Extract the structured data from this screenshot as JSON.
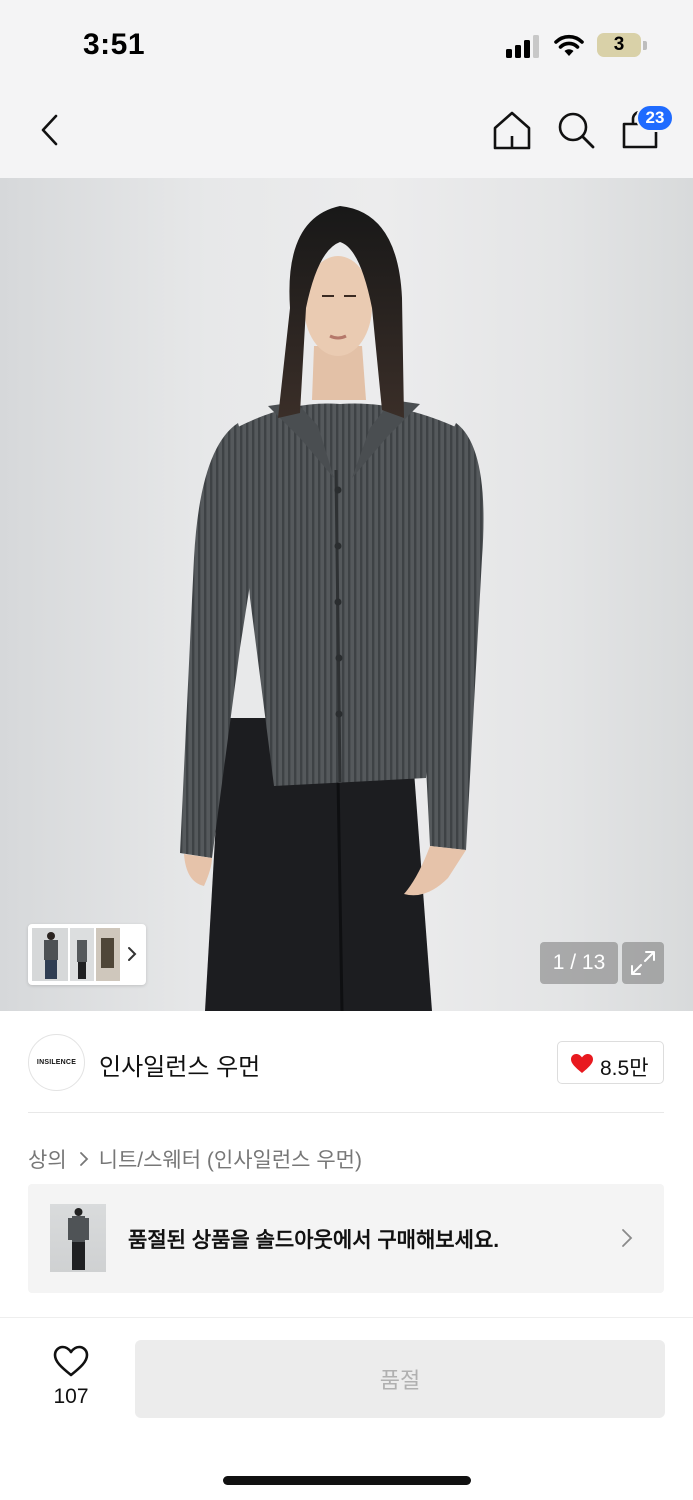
{
  "status_bar": {
    "time": "3:51",
    "battery_level": "3",
    "signal_bars_filled": 3,
    "signal_bars_total": 4
  },
  "nav": {
    "back_icon": "chevron-left-icon",
    "home_icon": "home-icon",
    "search_icon": "search-icon",
    "cart_icon": "shopping-bag-icon",
    "cart_count": "23",
    "badge_color": "#1f6bff"
  },
  "gallery": {
    "counter": "1 / 13",
    "expand_icon": "expand-icon"
  },
  "brand": {
    "logo_text": "INSILENCE",
    "name": "인사일런스 우먼",
    "likes": "8.5만",
    "heart_color": "#e8191f"
  },
  "breadcrumb": {
    "category": "상의",
    "subcategory": "니트/스웨터 (인사일런스 우먼)"
  },
  "soldout_banner": {
    "text": "품절된 상품을 솔드아웃에서 구매해보세요."
  },
  "bottom_bar": {
    "wish_count": "107",
    "buy_button_label": "품절"
  }
}
